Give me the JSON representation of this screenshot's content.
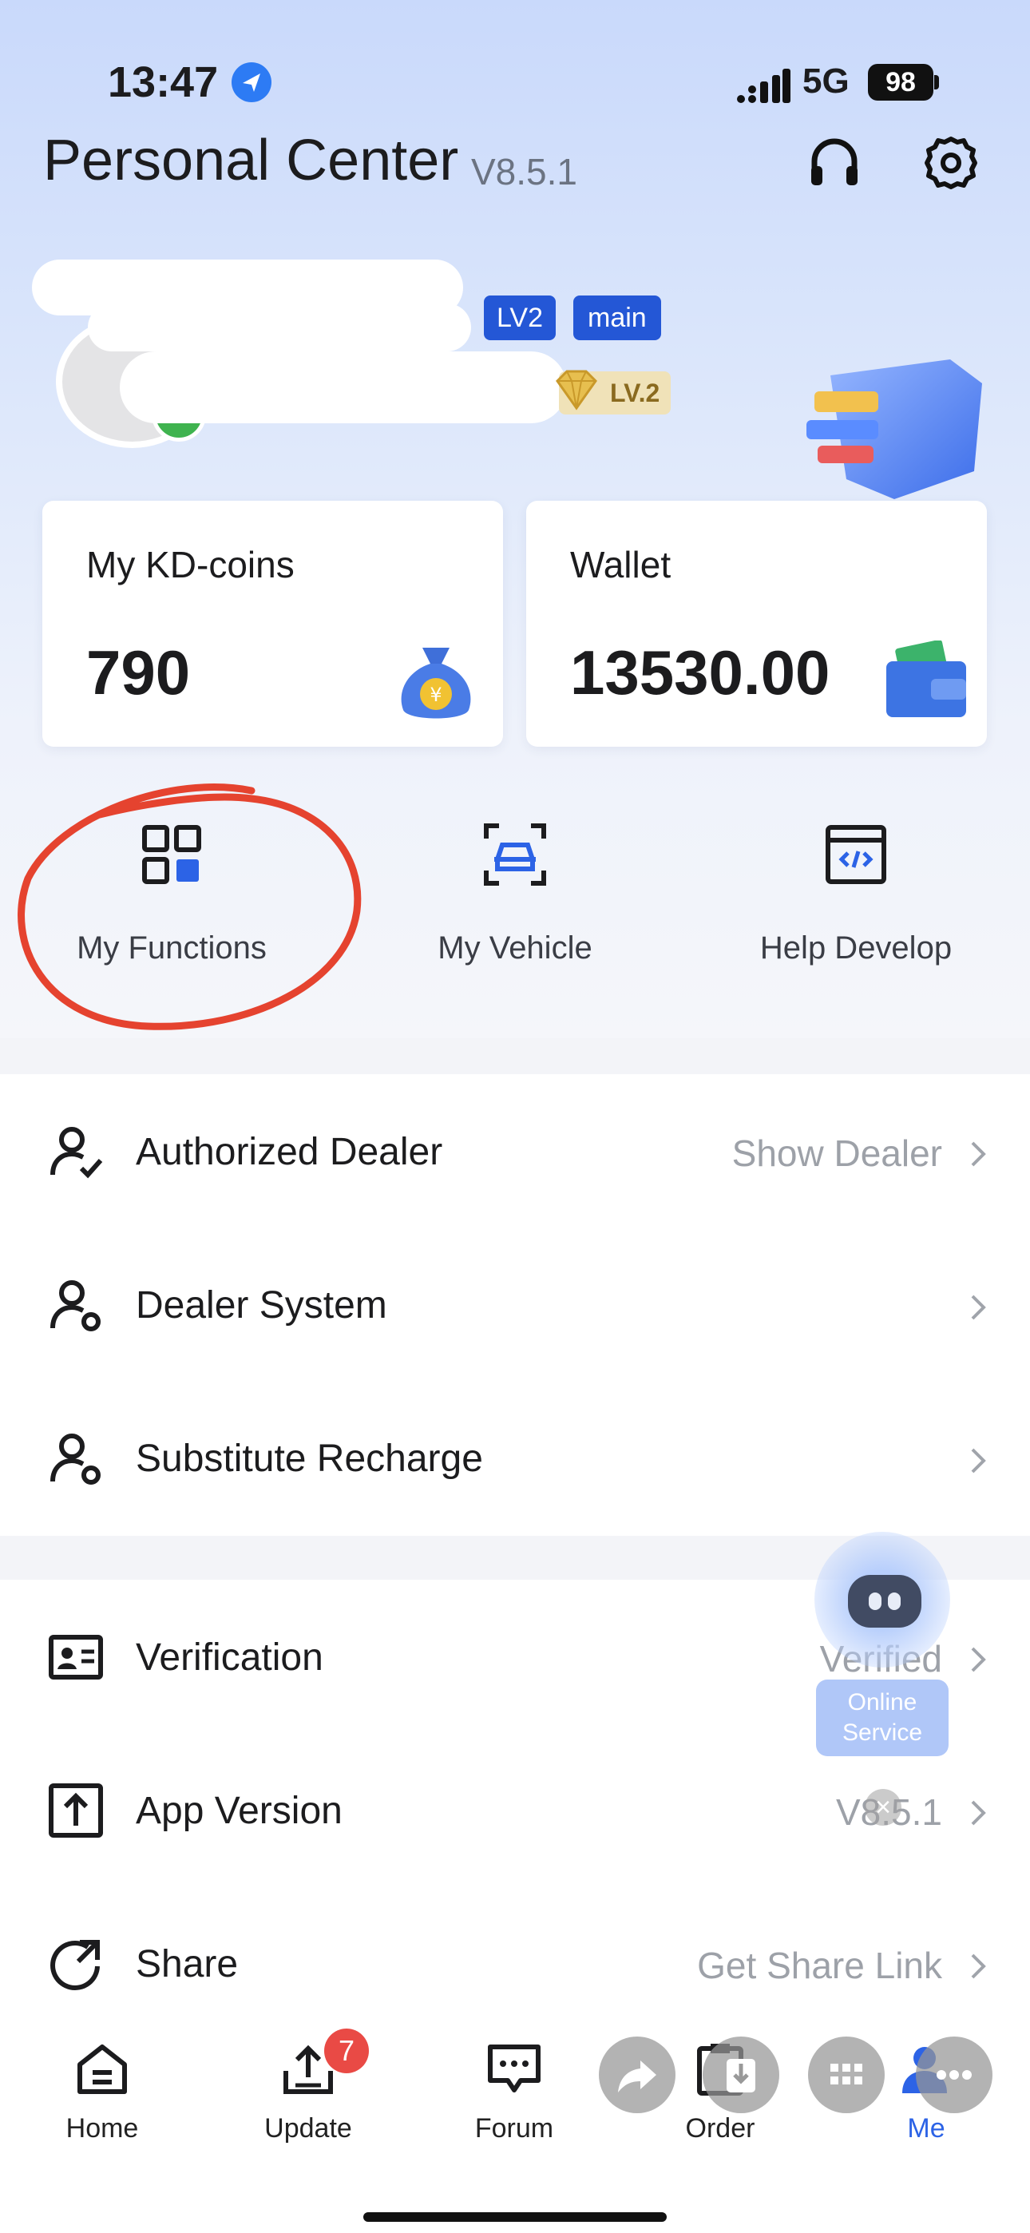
{
  "status_bar": {
    "time": "13:47",
    "network": "5G",
    "battery": "98"
  },
  "header": {
    "title": "Personal Center",
    "version": "V8.5.1"
  },
  "profile": {
    "level_badge": "LV2",
    "account_badge": "main",
    "vip_level": "LV.2"
  },
  "cards": {
    "coins": {
      "label": "My KD-coins",
      "value": "790"
    },
    "wallet": {
      "label": "Wallet",
      "value": "13530.00"
    }
  },
  "functions": [
    {
      "label": "My Functions"
    },
    {
      "label": "My Vehicle"
    },
    {
      "label": "Help Develop"
    }
  ],
  "menu_group1": [
    {
      "label": "Authorized Dealer",
      "value": "Show Dealer"
    },
    {
      "label": "Dealer System",
      "value": ""
    },
    {
      "label": "Substitute Recharge",
      "value": ""
    }
  ],
  "menu_group2": [
    {
      "label": "Verification",
      "value": "Verified"
    },
    {
      "label": "App Version",
      "value": "V8.5.1"
    },
    {
      "label": "Share",
      "value": "Get Share Link"
    }
  ],
  "online_service": {
    "line1": "Online",
    "line2": "Service"
  },
  "tabbar": {
    "home": "Home",
    "update": "Update",
    "update_badge": "7",
    "forum": "Forum",
    "order": "Order",
    "me": "Me"
  },
  "colors": {
    "accent": "#2c63e6",
    "badge_blue": "#2457d6",
    "annotation_red": "#e5432f"
  }
}
